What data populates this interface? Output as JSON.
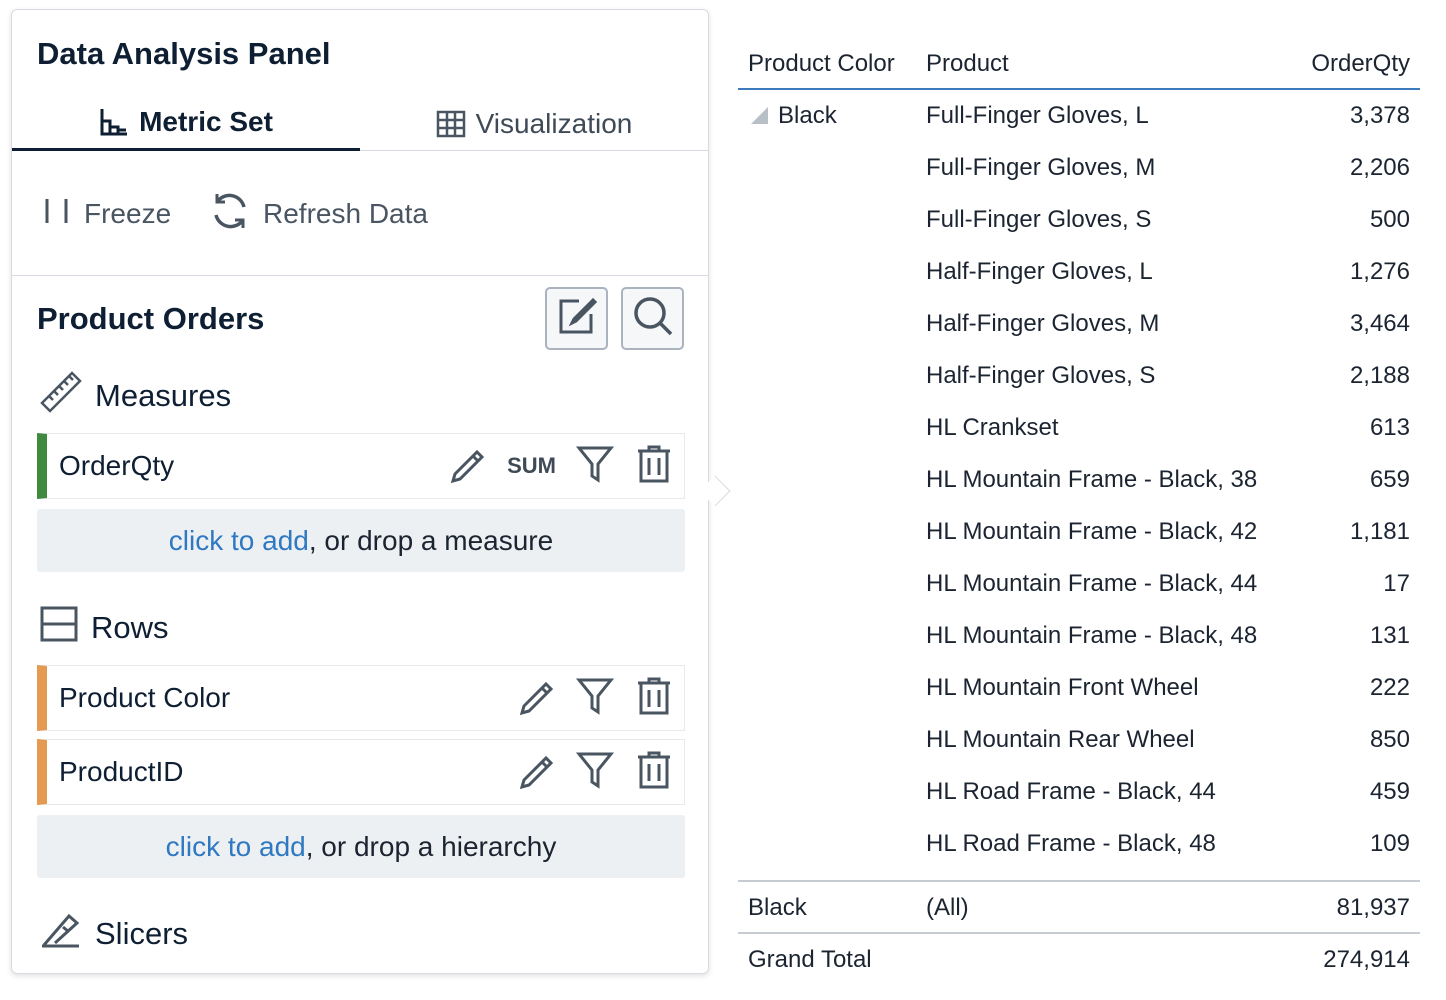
{
  "panel": {
    "title": "Data Analysis Panel",
    "tabs": [
      {
        "label": "Metric Set",
        "icon": "metric-set-icon",
        "active": true
      },
      {
        "label": "Visualization",
        "icon": "grid-table-icon",
        "active": false
      }
    ],
    "toolbar": {
      "freeze_label": "Freeze",
      "refresh_label": "Refresh Data"
    },
    "section_title": "Product Orders",
    "measures": {
      "label": "Measures",
      "items": [
        {
          "name": "OrderQty",
          "aggregation": "SUM",
          "color": "#3f8a3f"
        }
      ],
      "dropzone_link": "click to add",
      "dropzone_text": ", or drop a measure"
    },
    "rows": {
      "label": "Rows",
      "items": [
        {
          "name": "Product Color",
          "color": "#e59a52"
        },
        {
          "name": "ProductID",
          "color": "#e59a52"
        }
      ],
      "dropzone_link": "click to add",
      "dropzone_text": ", or drop a hierarchy"
    },
    "slicers": {
      "label": "Slicers"
    }
  },
  "table": {
    "headers": [
      "Product Color",
      "Product",
      "OrderQty"
    ],
    "group_label": "Black",
    "rows": [
      {
        "product": "Full-Finger Gloves, L",
        "qty": "3,378"
      },
      {
        "product": "Full-Finger Gloves, M",
        "qty": "2,206"
      },
      {
        "product": "Full-Finger Gloves, S",
        "qty": "500"
      },
      {
        "product": "Half-Finger Gloves, L",
        "qty": "1,276"
      },
      {
        "product": "Half-Finger Gloves, M",
        "qty": "3,464"
      },
      {
        "product": "Half-Finger Gloves, S",
        "qty": "2,188"
      },
      {
        "product": "HL Crankset",
        "qty": "613"
      },
      {
        "product": "HL Mountain Frame - Black, 38",
        "qty": "659"
      },
      {
        "product": "HL Mountain Frame - Black, 42",
        "qty": "1,181"
      },
      {
        "product": "HL Mountain Frame - Black, 44",
        "qty": "17"
      },
      {
        "product": "HL Mountain Frame - Black, 48",
        "qty": "131"
      },
      {
        "product": "HL Mountain Front Wheel",
        "qty": "222"
      },
      {
        "product": "HL Mountain Rear Wheel",
        "qty": "850"
      },
      {
        "product": "HL Road Frame - Black, 44",
        "qty": "459"
      },
      {
        "product": "HL Road Frame - Black, 48",
        "qty": "109"
      }
    ],
    "subtotal": {
      "color": "Black",
      "product": "(All)",
      "qty": "81,937"
    },
    "grand_total": {
      "label": "Grand Total",
      "qty": "274,914"
    },
    "accent_color": "#3c79bd"
  }
}
